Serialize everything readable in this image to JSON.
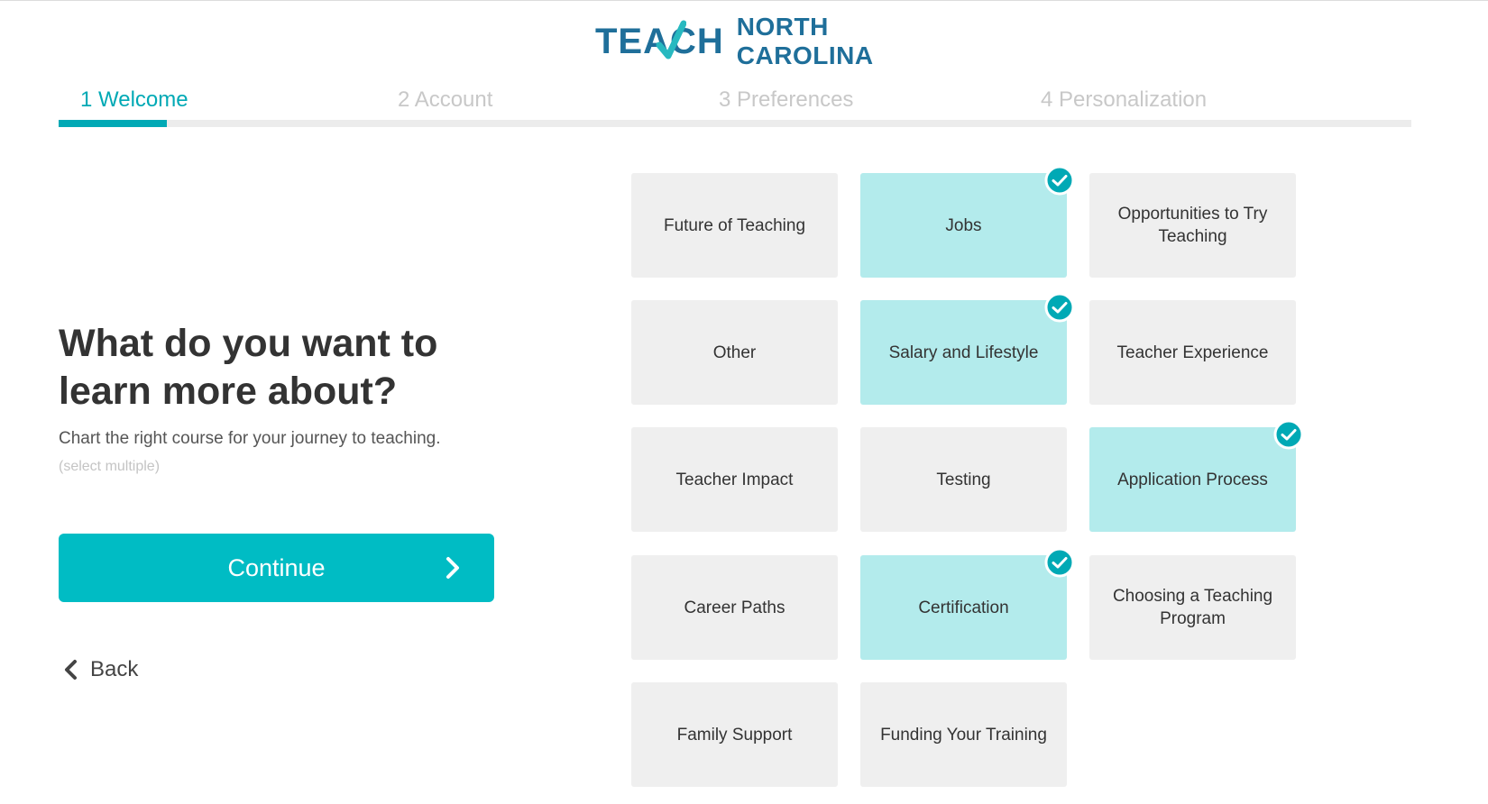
{
  "logo": {
    "teach": "TEACH",
    "state_line1": "NORTH",
    "state_line2": "CAROLINA"
  },
  "steps": [
    {
      "label": "1 Welcome",
      "active": true
    },
    {
      "label": "2 Account",
      "active": false
    },
    {
      "label": "3 Preferences",
      "active": false
    },
    {
      "label": "4 Personalization",
      "active": false
    }
  ],
  "progress": {
    "current_step": 1,
    "total_steps": 4
  },
  "main": {
    "heading": "What do you want to learn more about?",
    "subtext": "Chart the right course for your journey to teaching.",
    "hint": "(select multiple)",
    "continue_label": "Continue",
    "back_label": "Back"
  },
  "topics": [
    {
      "label": "Future of Teaching",
      "selected": false
    },
    {
      "label": "Jobs",
      "selected": true
    },
    {
      "label": "Opportunities to Try Teaching",
      "selected": false
    },
    {
      "label": "Other",
      "selected": false
    },
    {
      "label": "Salary and Lifestyle",
      "selected": true
    },
    {
      "label": "Teacher Experience",
      "selected": false
    },
    {
      "label": "Teacher Impact",
      "selected": false
    },
    {
      "label": "Testing",
      "selected": false
    },
    {
      "label": "Application Process",
      "selected": true
    },
    {
      "label": "Career Paths",
      "selected": false
    },
    {
      "label": "Certification",
      "selected": true
    },
    {
      "label": "Choosing a Teaching Program",
      "selected": false
    },
    {
      "label": "Family Support",
      "selected": false
    },
    {
      "label": "Funding Your Training",
      "selected": false
    }
  ],
  "colors": {
    "brand_blue": "#1f6f9a",
    "accent_teal": "#00a9b5",
    "button_teal": "#00bcc4",
    "tile_default": "#efefef",
    "tile_selected": "#b3ebec"
  },
  "icons": {
    "check_badge": "check-circle-icon",
    "continue_arrow": "chevron-right-icon",
    "back_arrow": "chevron-left-icon",
    "logo_check": "checkmark-icon"
  }
}
